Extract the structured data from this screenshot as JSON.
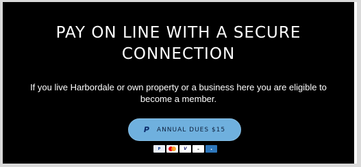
{
  "hero": {
    "title": "PAY ON LINE WITH A SECURE\nCONNECTION",
    "description": "If you live Harbordale or own property or a business here you are eligible to become a member."
  },
  "button": {
    "label": "ANNUAL DUES $15",
    "icon": "paypal-icon"
  },
  "payment_methods": [
    "paypal-icon",
    "mastercard-icon",
    "visa-icon",
    "discover-icon",
    "amex-icon"
  ],
  "colors": {
    "background": "#000000",
    "text": "#ffffff",
    "button": "#6fb0de"
  }
}
